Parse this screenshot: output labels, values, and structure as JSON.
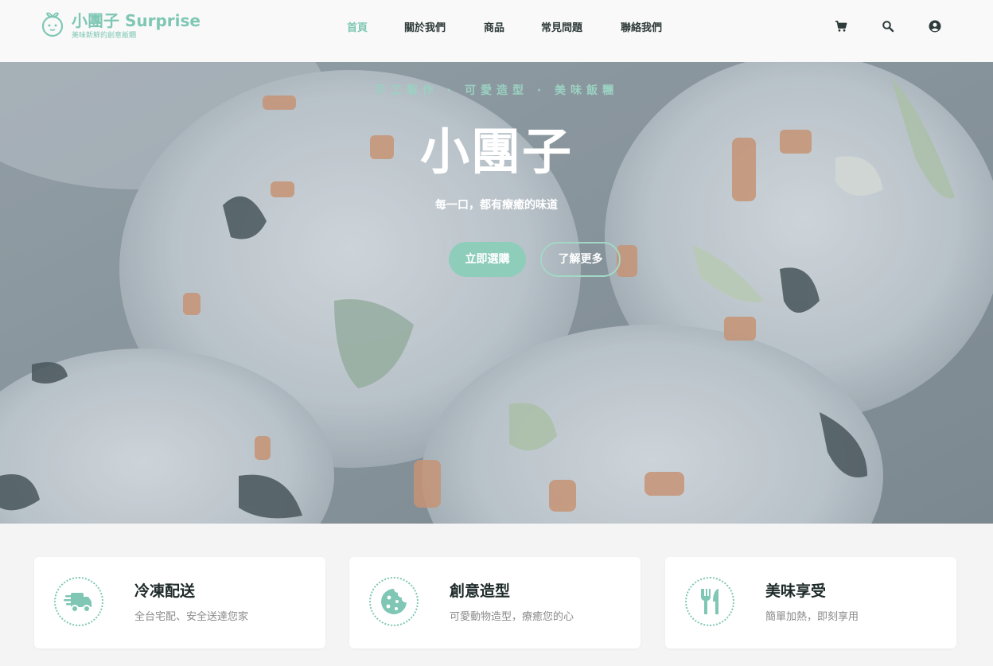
{
  "brand": {
    "title": "小團子 Surprise",
    "subtitle": "美味新鮮的創意飯糰",
    "accent": "#7fc7b4"
  },
  "nav": {
    "items": [
      {
        "label": "首頁",
        "active": true
      },
      {
        "label": "關於我們"
      },
      {
        "label": "商品"
      },
      {
        "label": "常見問題"
      },
      {
        "label": "聯絡我們"
      }
    ],
    "icons": [
      "cart-icon",
      "search-icon",
      "user-icon"
    ]
  },
  "hero": {
    "tagline": "手工製作 · 可愛造型 · 美味飯糰",
    "title": "小團子",
    "subtitle": "每一口，都有療癒的味道",
    "primary_button": "立即選購",
    "secondary_button": "了解更多"
  },
  "features": [
    {
      "icon": "truck-icon",
      "title": "冷凍配送",
      "desc": "全台宅配、安全送達您家"
    },
    {
      "icon": "cookie-icon",
      "title": "創意造型",
      "desc": "可愛動物造型，療癒您的心"
    },
    {
      "icon": "utensils-icon",
      "title": "美味享受",
      "desc": "簡單加熱，即刻享用"
    }
  ]
}
